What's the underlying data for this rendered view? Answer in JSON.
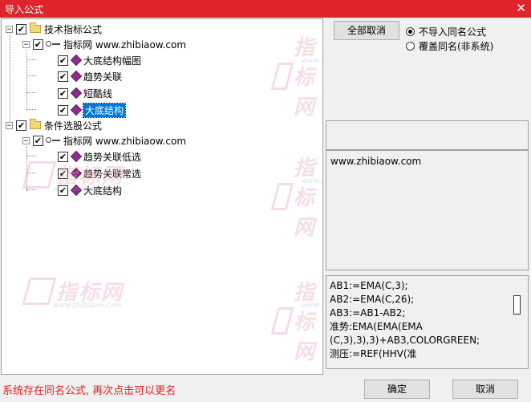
{
  "window": {
    "title": "导入公式",
    "close_glyph": "✕"
  },
  "tree": {
    "group1": {
      "label": "技术指标公式",
      "expand": "−"
    },
    "source1": {
      "label": "指标网 www.zhibiaow.com",
      "expand": "−"
    },
    "items1": [
      "大底结构幅图",
      "趋势关联",
      "短酷线",
      "大底结构"
    ],
    "group2": {
      "label": "条件选股公式",
      "expand": "−"
    },
    "source2": {
      "label": "指标网 www.zhibiaow.com",
      "expand": "−"
    },
    "items2": [
      "趋势关联低选",
      "趋势关联常选",
      "大底结构"
    ],
    "check_glyph": "✔"
  },
  "right": {
    "cancel_all": "全部取消",
    "radio_no_import": "不导入同名公式",
    "radio_overwrite": "覆盖同名(非系统)",
    "site": "www.zhibiaow.com",
    "code": "AB1:=EMA(C,3);\nAB2:=EMA(C,26);\nAB3:=AB1-AB2;\n准势:EMA(EMA(EMA\n(C,3),3),3)+AB3,COLORGREEN;\n测压:=REF(HHV(准"
  },
  "watermark": {
    "text": "指标网",
    "sub": "www.zhibiaow.com"
  },
  "footer": {
    "status": "系统存在同名公式, 再次点击可以更名",
    "ok": "确定",
    "cancel": "取消"
  }
}
